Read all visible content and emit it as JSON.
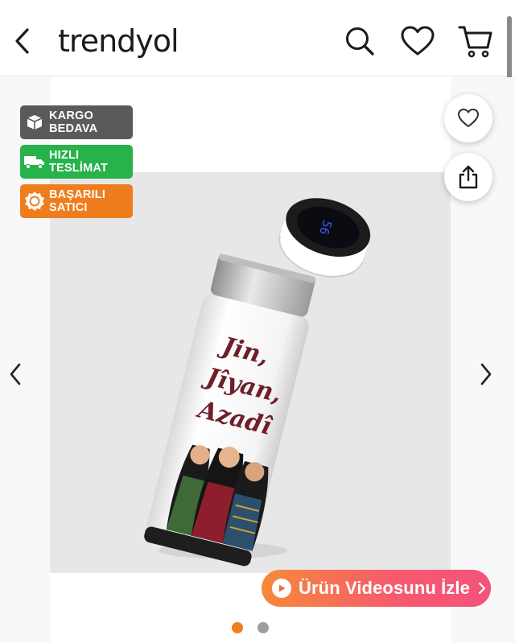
{
  "header": {
    "logo": "trendyol",
    "back_icon": "chevron-left-icon",
    "search_icon": "search-icon",
    "favorites_icon": "heart-icon",
    "cart_icon": "cart-icon"
  },
  "badges": [
    {
      "label": "KARGO\nBEDAVA",
      "icon": "box-icon",
      "color": "#5a5a5a"
    },
    {
      "label": "HIZLI\nTESLİMAT",
      "icon": "truck-icon",
      "color": "#27b24a"
    },
    {
      "label": "BAŞARILI\nSATICI",
      "icon": "award-icon",
      "color": "#ef7d1d"
    }
  ],
  "product_image": {
    "printed_text": [
      "Jin,",
      "Jîyan,",
      "Azadî"
    ],
    "display_reading": "56"
  },
  "actions": {
    "favorite_icon": "heart-outline-icon",
    "share_icon": "share-icon"
  },
  "video_button": {
    "label": "Ürün Videosunu İzle",
    "icon": "play-icon"
  },
  "pagination": {
    "count": 2,
    "active_index": 0,
    "active_color": "#ef7d1d",
    "inactive_color": "#9e9e9e"
  },
  "colors": {
    "brand_orange": "#f27a1a",
    "text_dark": "#1b1b1b"
  }
}
